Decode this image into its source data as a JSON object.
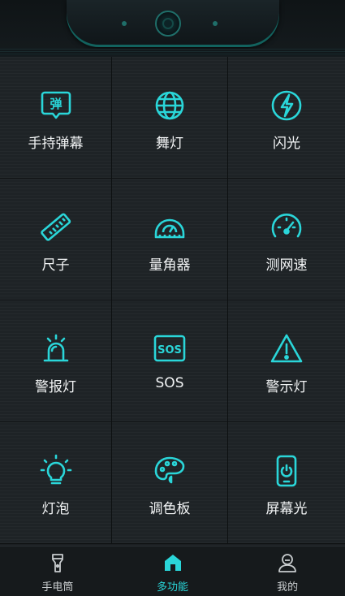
{
  "accent": "#2ad6d9",
  "features": [
    {
      "label": "手持弹幕",
      "icon": "danmaku-icon"
    },
    {
      "label": "舞灯",
      "icon": "globe-icon"
    },
    {
      "label": "闪光",
      "icon": "flash-icon"
    },
    {
      "label": "尺子",
      "icon": "ruler-icon"
    },
    {
      "label": "量角器",
      "icon": "protractor-icon"
    },
    {
      "label": "测网速",
      "icon": "speedometer-icon"
    },
    {
      "label": "警报灯",
      "icon": "alarm-light-icon"
    },
    {
      "label": "SOS",
      "icon": "sos-icon"
    },
    {
      "label": "警示灯",
      "icon": "warning-icon"
    },
    {
      "label": "灯泡",
      "icon": "bulb-icon"
    },
    {
      "label": "调色板",
      "icon": "palette-icon"
    },
    {
      "label": "屏幕光",
      "icon": "phone-light-icon"
    }
  ],
  "tabs": [
    {
      "label": "手电筒",
      "icon": "flashlight-icon",
      "active": false
    },
    {
      "label": "多功能",
      "icon": "home-icon",
      "active": true
    },
    {
      "label": "我的",
      "icon": "profile-icon",
      "active": false
    }
  ]
}
